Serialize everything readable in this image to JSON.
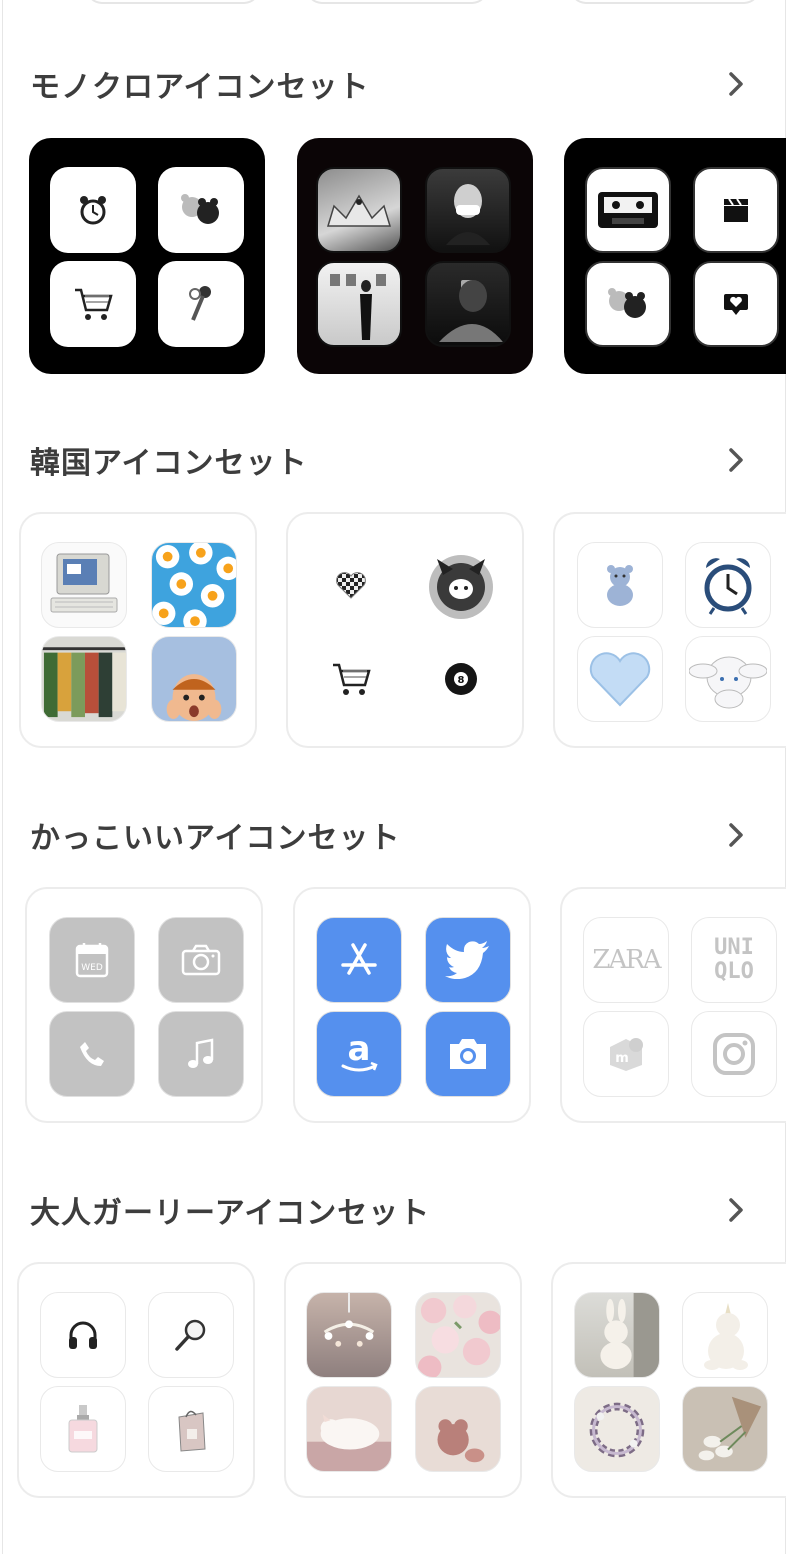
{
  "sections": [
    {
      "title": "モノクロアイコンセット",
      "cards": [
        {
          "tiles": [
            {
              "icon": "alarm-clock-icon"
            },
            {
              "icon": "bear-plush-icon"
            },
            {
              "icon": "shopping-cart-icon"
            },
            {
              "icon": "keys-icon"
            }
          ]
        },
        {
          "tiles": [
            {
              "icon": "tiara-photo"
            },
            {
              "icon": "masked-girl-photo"
            },
            {
              "icon": "gallery-girl-photo"
            },
            {
              "icon": "mirror-selfie-photo"
            }
          ]
        },
        {
          "tiles": [
            {
              "icon": "cassette-icon"
            },
            {
              "icon": "clapperboard-icon"
            },
            {
              "icon": "bear-plush-icon"
            },
            {
              "icon": "heart-bubble-icon"
            }
          ]
        }
      ]
    },
    {
      "title": "韓国アイコンセット",
      "cards": [
        {
          "tiles": [
            {
              "icon": "retro-computer-photo"
            },
            {
              "icon": "fried-eggs-photo"
            },
            {
              "icon": "clothes-rack-photo"
            },
            {
              "icon": "surprised-kid-photo"
            }
          ]
        },
        {
          "tiles": [
            {
              "icon": "checkered-heart-icon"
            },
            {
              "icon": "kuromi-icon"
            },
            {
              "icon": "shopping-cart-icon"
            },
            {
              "icon": "eight-ball-icon"
            }
          ]
        },
        {
          "tiles": [
            {
              "icon": "blue-bear-icon"
            },
            {
              "icon": "blue-alarm-clock-icon"
            },
            {
              "icon": "blue-heart-icon"
            },
            {
              "icon": "cinnamoroll-icon"
            }
          ]
        }
      ]
    },
    {
      "title": "かっこいいアイコンセット",
      "cards": [
        {
          "tiles": [
            {
              "icon": "calendar-icon",
              "text": "WED"
            },
            {
              "icon": "camera-icon"
            },
            {
              "icon": "phone-icon"
            },
            {
              "icon": "music-note-icon"
            }
          ]
        },
        {
          "tiles": [
            {
              "icon": "app-store-icon"
            },
            {
              "icon": "twitter-bird-icon"
            },
            {
              "icon": "amazon-icon",
              "text": "a"
            },
            {
              "icon": "camera-icon"
            }
          ]
        },
        {
          "tiles": [
            {
              "icon": "zara-logo",
              "text": "ZARA"
            },
            {
              "icon": "uniqlo-logo",
              "text": "UNI QLO"
            },
            {
              "icon": "mercari-icon",
              "text": "m"
            },
            {
              "icon": "instagram-icon"
            }
          ]
        }
      ]
    },
    {
      "title": "大人ガーリーアイコンセット",
      "cards": [
        {
          "tiles": [
            {
              "icon": "headphones-icon"
            },
            {
              "icon": "magnifier-icon"
            },
            {
              "icon": "perfume-icon"
            },
            {
              "icon": "shopping-bag-icon"
            }
          ]
        },
        {
          "tiles": [
            {
              "icon": "chandelier-photo"
            },
            {
              "icon": "roses-photo"
            },
            {
              "icon": "kitten-photo"
            },
            {
              "icon": "teddy-photo"
            }
          ]
        },
        {
          "tiles": [
            {
              "icon": "bunny-plush-photo"
            },
            {
              "icon": "unicorn-plush-photo"
            },
            {
              "icon": "wreath-photo"
            },
            {
              "icon": "bouquet-photo"
            }
          ]
        }
      ]
    }
  ],
  "colors": {
    "title": "#3d3d3d",
    "accent_blue": "#5590ee",
    "tile_gray": "#c2c2c2",
    "border": "#ececec"
  }
}
